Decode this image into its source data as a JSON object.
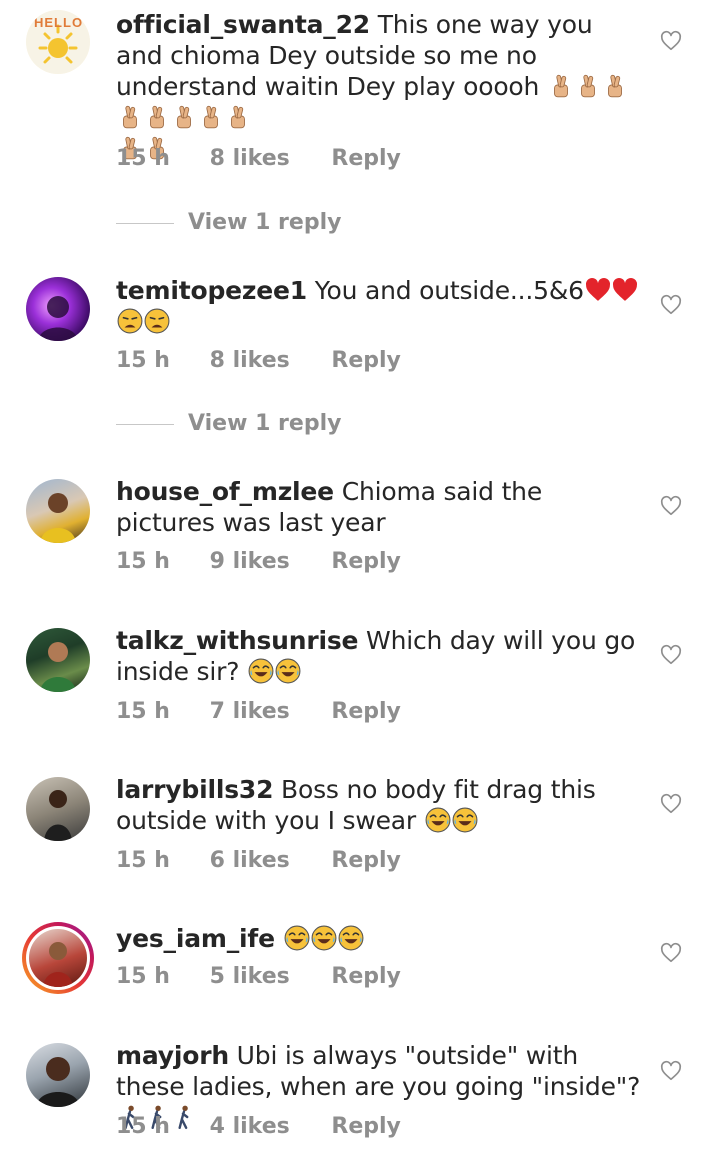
{
  "comments": [
    {
      "username": "official_swanta_22",
      "text": "This one way you and chioma Dey outside so me no understand waitin Dey play ooooh",
      "emoji": "fingers-crossed",
      "emoji_count": 10,
      "time": "15 h",
      "likes": "8 likes",
      "reply": "Reply",
      "view_replies": "View 1 reply",
      "avatar_text": "HELLO"
    },
    {
      "username": "temitopezee1",
      "text": "You and outside...5&6",
      "emoji": "heart + weary-face",
      "time": "15 h",
      "likes": "8 likes",
      "reply": "Reply",
      "view_replies": "View 1 reply"
    },
    {
      "username": "house_of_mzlee",
      "text": "Chioma said the pictures was last year",
      "time": "15 h",
      "likes": "9 likes",
      "reply": "Reply"
    },
    {
      "username": "talkz_withsunrise",
      "text": "Which day will you go inside sir?",
      "emoji": "tears-of-joy",
      "time": "15 h",
      "likes": "7 likes",
      "reply": "Reply"
    },
    {
      "username": "larrybills32",
      "text": "Boss no body fit drag this outside with you I swear",
      "emoji": "tears-of-joy",
      "time": "15 h",
      "likes": "6 likes",
      "reply": "Reply"
    },
    {
      "username": "yes_iam_ife",
      "text": "",
      "emoji": "tears-of-joy",
      "time": "15 h",
      "likes": "5 likes",
      "reply": "Reply"
    },
    {
      "username": "mayjorh",
      "text": "Ubi is always \"outside\" with these ladies, when are you going \"inside\"?",
      "emoji": "person-walking",
      "time": "15 h",
      "likes": "4 likes",
      "reply": "Reply"
    }
  ],
  "colors": {
    "text": "#262626",
    "meta": "#8e8e8e",
    "heart_outline": "#8e8e8e",
    "emoji_yellow": "#f7c23a",
    "heart_red": "#e3242b"
  }
}
